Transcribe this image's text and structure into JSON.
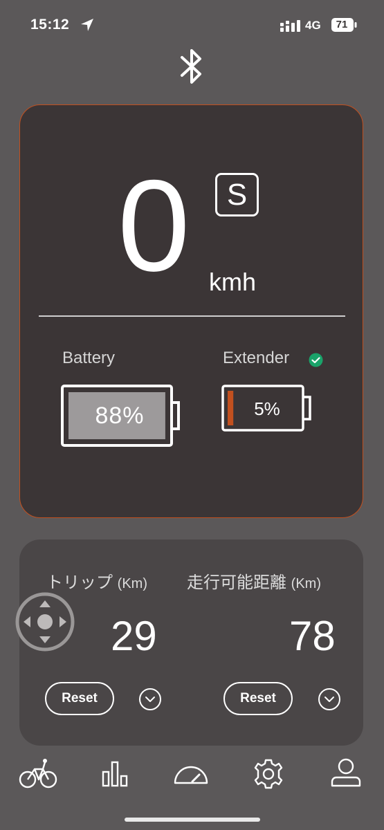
{
  "status_bar": {
    "time": "15:12",
    "network": "4G",
    "battery_level": "71"
  },
  "icons": {
    "location": "location-arrow-icon",
    "signal": "cellular-signal-icon",
    "bluetooth": "bluetooth-icon",
    "check": "check-circle-icon",
    "dpad": "dpad-icon"
  },
  "speed": {
    "value": "0",
    "mode": "S",
    "unit": "kmh"
  },
  "battery": {
    "label": "Battery",
    "percent_text": "88%",
    "level": 0.88
  },
  "extender": {
    "label": "Extender",
    "percent_text": "5%",
    "level": 0.05,
    "connected": true
  },
  "trip": {
    "label": "トリップ",
    "unit": "(Km)",
    "value": "29",
    "reset_label": "Reset"
  },
  "range": {
    "label": "走行可能距離",
    "unit": "(Km)",
    "value": "78",
    "reset_label": "Reset"
  },
  "tabs": [
    {
      "name": "bike-icon"
    },
    {
      "name": "bar-chart-icon"
    },
    {
      "name": "speedometer-icon"
    },
    {
      "name": "gear-icon"
    },
    {
      "name": "profile-icon"
    }
  ],
  "colors": {
    "accent": "#c2501f",
    "check_green": "#1aa36a",
    "card_bg": "#3b3536",
    "page_bg": "#5b5859"
  }
}
